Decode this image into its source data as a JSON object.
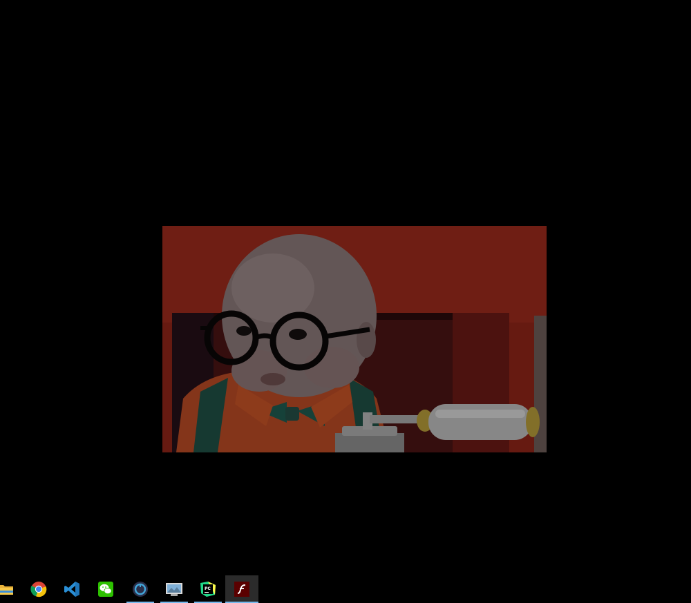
{
  "desktop": {
    "background_color": "#000000",
    "photo": {
      "subject": "baby-with-round-glasses-and-telephone",
      "dim_overlay": true
    }
  },
  "taskbar": {
    "apps": [
      {
        "name": "file-explorer",
        "icon": "folder-icon",
        "running": false,
        "active": false
      },
      {
        "name": "google-chrome",
        "icon": "chrome-icon",
        "running": false,
        "active": false
      },
      {
        "name": "visual-studio-code",
        "icon": "vscode-icon",
        "running": false,
        "active": false
      },
      {
        "name": "wechat",
        "icon": "wechat-icon",
        "running": false,
        "active": false
      },
      {
        "name": "obs-like-app",
        "icon": "circle-app-icon",
        "running": true,
        "active": false
      },
      {
        "name": "image-viewer",
        "icon": "photos-icon",
        "running": true,
        "active": false
      },
      {
        "name": "pycharm",
        "icon": "pycharm-icon",
        "running": true,
        "active": false
      },
      {
        "name": "adobe-flash",
        "icon": "flash-icon",
        "running": true,
        "active": true
      }
    ],
    "accent_color": "#76b9ed"
  }
}
